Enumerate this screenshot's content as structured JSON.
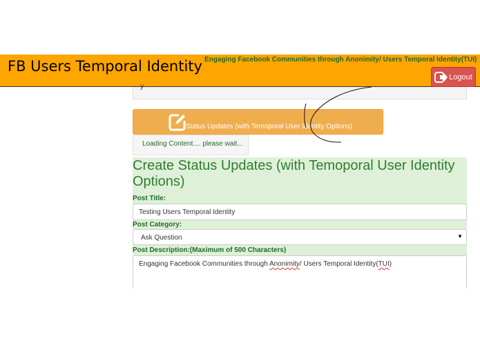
{
  "header": {
    "brand": "FB Users Temporal Identity",
    "tagline": "Engaging Facebook Communities through Anonimity/ Users Temporal Identity(TUI)",
    "logout_label": "Logout"
  },
  "strip_text": "y",
  "status_button": {
    "label": "Status Updates (with Temoporal User Identity Options)",
    "icon": "edit-square-icon"
  },
  "loading_text": "Loading Content.... please wait...",
  "form": {
    "title": "Create Status Updates (with Temoporal User Identity Options)",
    "post_title_label": "Post Title:",
    "post_title_value": "Testing Users Temporal Identity",
    "post_category_label": "Post Category:",
    "post_category_value": "Ask Question",
    "post_description_label": "Post Description:(Maximum of 500 Characters)",
    "post_description_parts": {
      "before": "Engaging Facebook Communities through ",
      "word1": "Anonimity",
      "middle": "/ Users Temporal Identity(",
      "word2": "TUI",
      "after": ")"
    }
  },
  "colors": {
    "header_bg": "#ffa500",
    "logout_bg": "#d9534f",
    "status_btn_bg": "#f0ad4e",
    "panel_bg": "#dff0d8",
    "label_green": "#1f6b2a"
  }
}
